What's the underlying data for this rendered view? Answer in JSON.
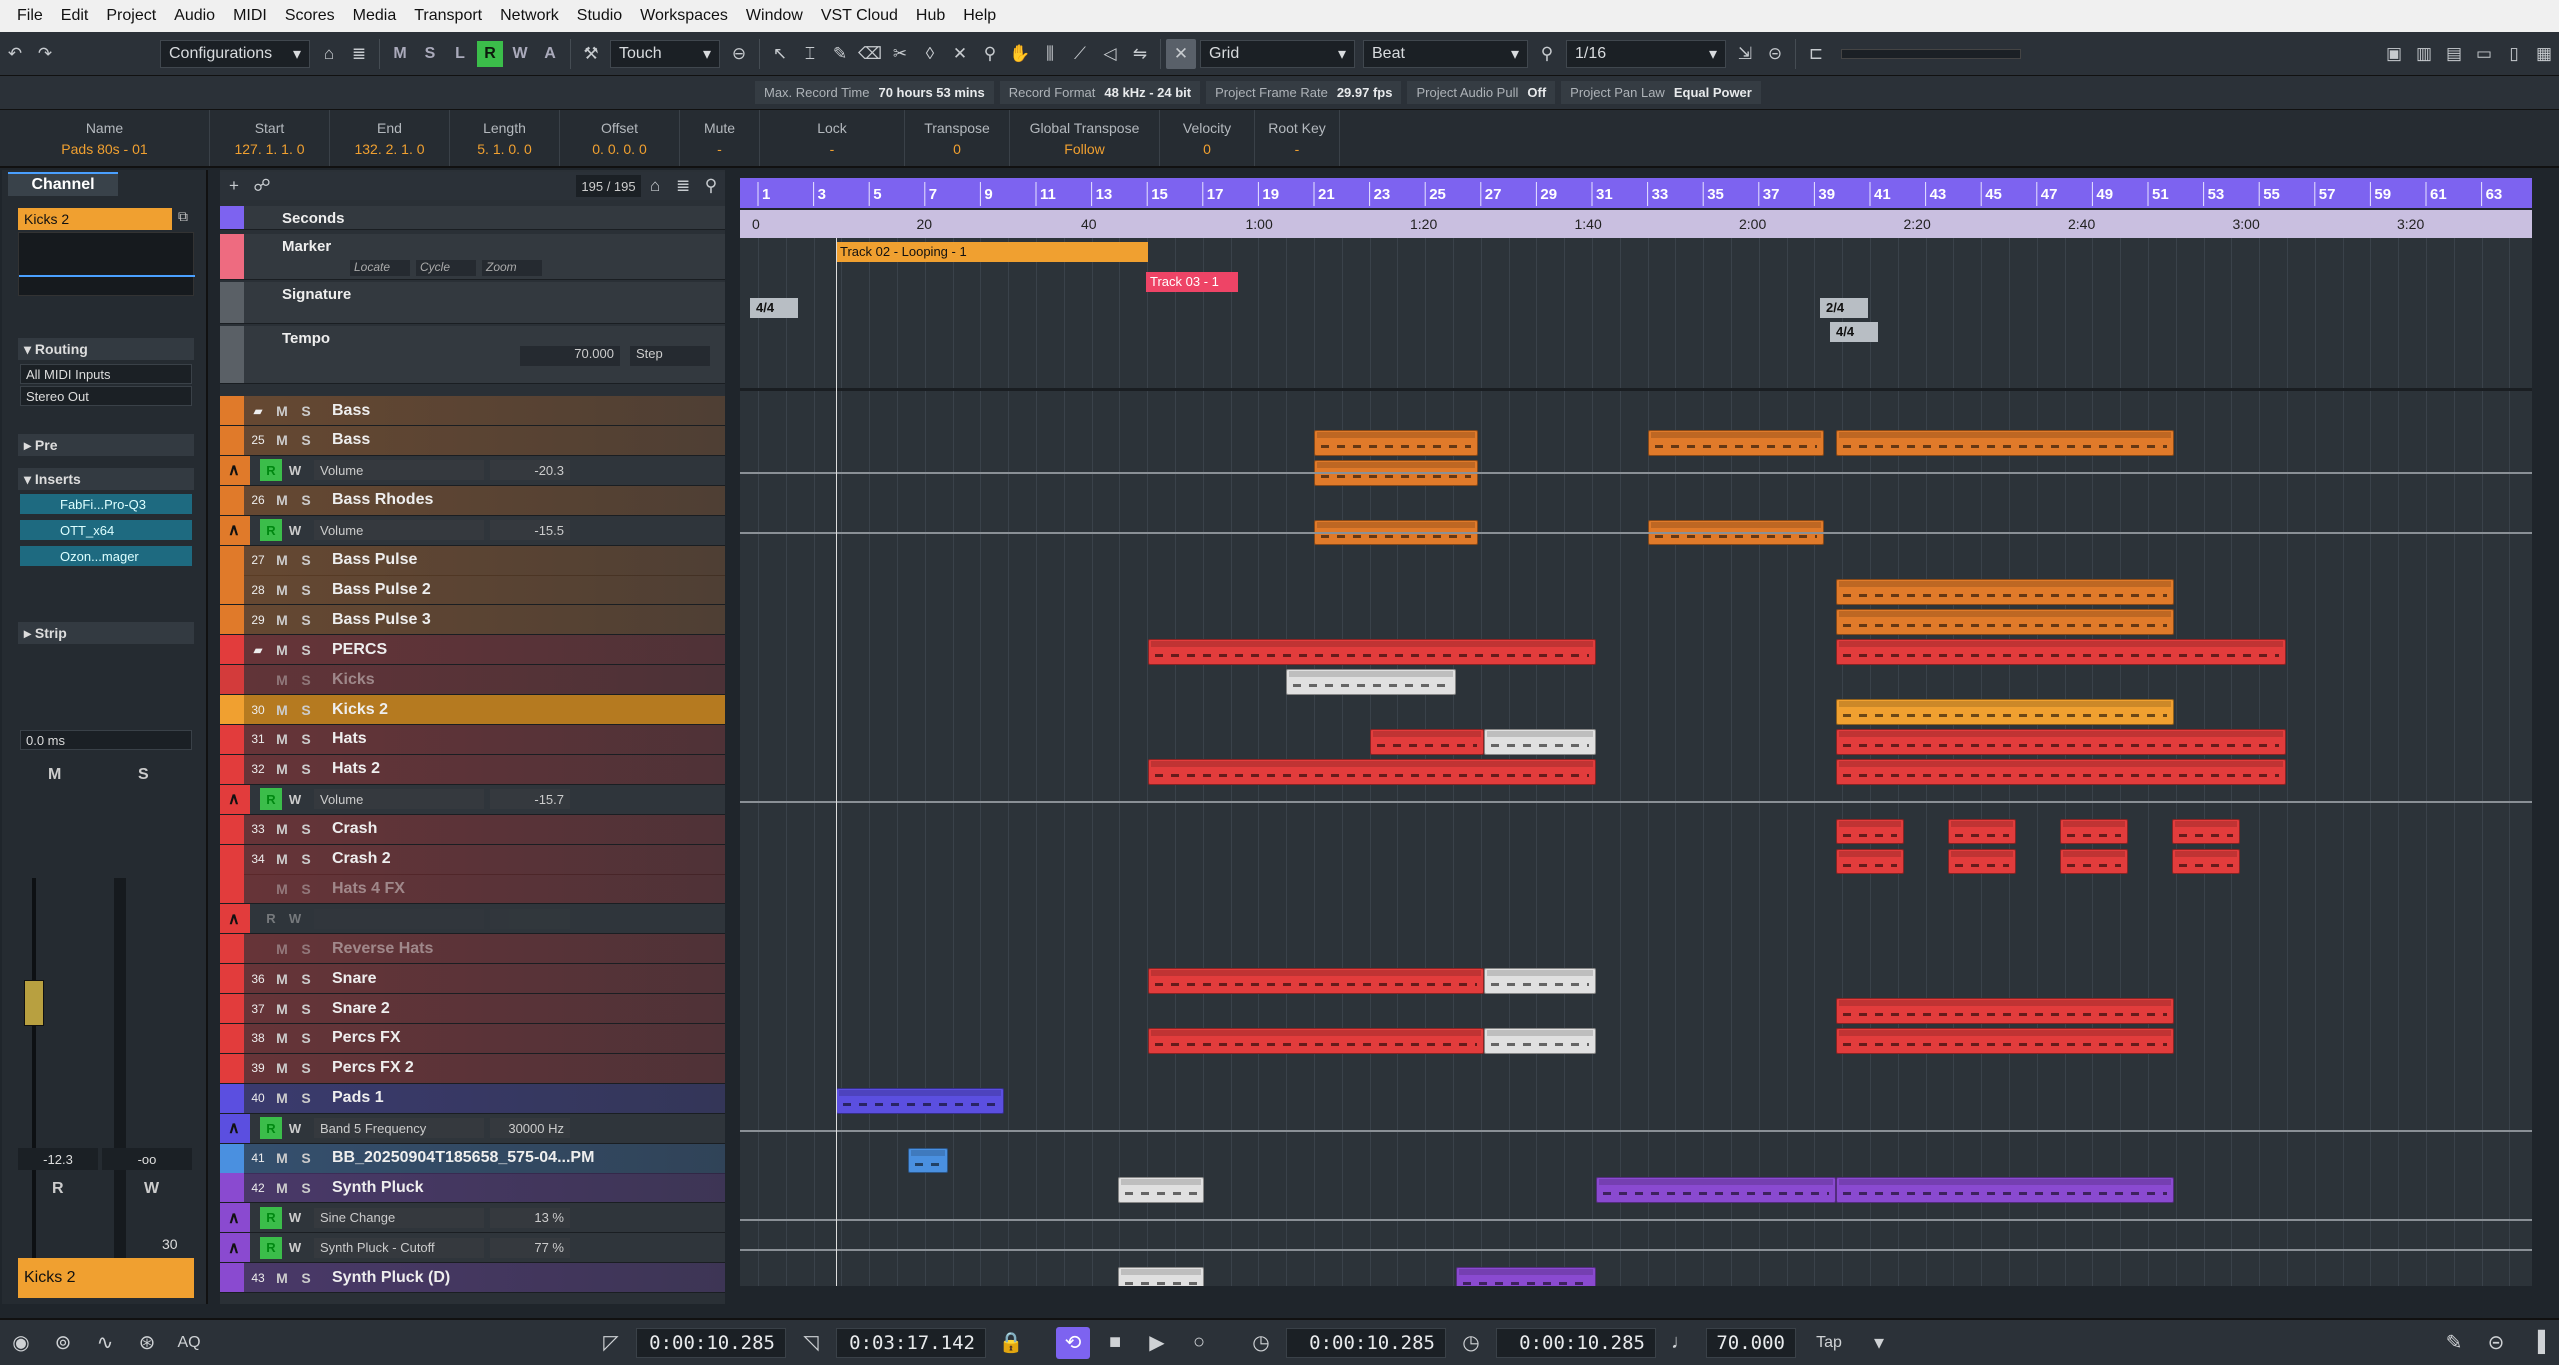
{
  "menu": [
    "File",
    "Edit",
    "Project",
    "Audio",
    "MIDI",
    "Scores",
    "Media",
    "Transport",
    "Network",
    "Studio",
    "Workspaces",
    "Window",
    "VST Cloud",
    "Hub",
    "Help"
  ],
  "toolbar": {
    "configurations": "Configurations",
    "automation_modes": [
      "M",
      "S",
      "L",
      "R",
      "W",
      "A"
    ],
    "automation_mode_active": "R",
    "touch_mode": "Touch",
    "snap_type": "Grid",
    "grid_type": "Beat",
    "quantize": "1/16"
  },
  "statusline": [
    {
      "label": "Max. Record Time",
      "value": "70 hours 53 mins"
    },
    {
      "label": "Record Format",
      "value": "48 kHz - 24 bit"
    },
    {
      "label": "Project Frame Rate",
      "value": "29.97 fps"
    },
    {
      "label": "Project Audio Pull",
      "value": "Off"
    },
    {
      "label": "Project Pan Law",
      "value": "Equal Power"
    }
  ],
  "infoline": [
    {
      "h": "Name",
      "v": "Pads 80s - 01"
    },
    {
      "h": "Start",
      "v": "127. 1. 1.   0"
    },
    {
      "h": "End",
      "v": "132. 2. 1.   0"
    },
    {
      "h": "Length",
      "v": "5. 1. 0.   0"
    },
    {
      "h": "Offset",
      "v": "0. 0. 0.   0"
    },
    {
      "h": "Mute",
      "v": "-"
    },
    {
      "h": "Lock",
      "v": "-"
    },
    {
      "h": "Transpose",
      "v": "0"
    },
    {
      "h": "Global Transpose",
      "v": "Follow"
    },
    {
      "h": "Velocity",
      "v": "0"
    },
    {
      "h": "Root Key",
      "v": "-"
    }
  ],
  "inspector": {
    "tab": "Channel",
    "track_name": "Kicks 2",
    "routing": "Routing",
    "input": "All MIDI Inputs",
    "output": "Stereo Out",
    "pre": "Pre",
    "inserts": "Inserts",
    "insert_slots": [
      "FabFi...Pro-Q3",
      "OTT_x64",
      "Ozon...mager"
    ],
    "strip": "Strip",
    "delay": "0.0 ms",
    "fader_value": "-12.3",
    "fader_peak": "-oo",
    "ch_number": "30",
    "bottom_name": "Kicks 2",
    "ms": [
      "M",
      "S"
    ],
    "rw": [
      "R",
      "W"
    ]
  },
  "tracklist": {
    "count": "195 / 195",
    "rulers": [
      {
        "name": "Seconds"
      },
      {
        "name": "Marker",
        "sub": [
          "Locate",
          "Cycle",
          "Zoom"
        ]
      },
      {
        "name": "Signature"
      },
      {
        "name": "Tempo",
        "value": "70.000",
        "mode": "Step"
      }
    ],
    "tracks": [
      {
        "type": "folder",
        "name": "Bass",
        "color": "#e07a2a"
      },
      {
        "type": "inst",
        "num": "25",
        "name": "Bass",
        "color": "#e07a2a"
      },
      {
        "type": "auto",
        "param": "Volume",
        "value": "-20.3",
        "color": "#e07a2a"
      },
      {
        "type": "inst",
        "num": "26",
        "name": "Bass Rhodes",
        "color": "#e07a2a"
      },
      {
        "type": "auto",
        "param": "Volume",
        "value": "-15.5",
        "color": "#e07a2a"
      },
      {
        "type": "inst",
        "num": "27",
        "name": "Bass Pulse",
        "color": "#e07a2a"
      },
      {
        "type": "inst",
        "num": "28",
        "name": "Bass Pulse 2",
        "color": "#e07a2a"
      },
      {
        "type": "inst",
        "num": "29",
        "name": "Bass Pulse 3",
        "color": "#e07a2a"
      },
      {
        "type": "folder",
        "name": "PERCS",
        "color": "#e23c3c"
      },
      {
        "type": "inst",
        "num": "",
        "name": "Kicks",
        "color": "#d33b3b",
        "disabled": true
      },
      {
        "type": "inst",
        "num": "30",
        "name": "Kicks 2",
        "color": "#f0a030",
        "selected": true
      },
      {
        "type": "inst",
        "num": "31",
        "name": "Hats",
        "color": "#e23c3c"
      },
      {
        "type": "inst",
        "num": "32",
        "name": "Hats 2",
        "color": "#e23c3c"
      },
      {
        "type": "auto",
        "param": "Volume",
        "value": "-15.7",
        "color": "#e23c3c"
      },
      {
        "type": "inst",
        "num": "33",
        "name": "Crash",
        "color": "#e23c3c"
      },
      {
        "type": "inst",
        "num": "34",
        "name": "Crash 2",
        "color": "#e23c3c"
      },
      {
        "type": "inst",
        "num": "",
        "name": "Hats 4 FX",
        "color": "#e23c3c",
        "disabled": true
      },
      {
        "type": "auto",
        "param": "",
        "value": "",
        "color": "#e23c3c",
        "disabled": true
      },
      {
        "type": "inst",
        "num": "",
        "name": "Reverse Hats",
        "color": "#e23c3c",
        "disabled": true
      },
      {
        "type": "inst",
        "num": "36",
        "name": "Snare",
        "color": "#e23c3c"
      },
      {
        "type": "inst",
        "num": "37",
        "name": "Snare 2",
        "color": "#e23c3c"
      },
      {
        "type": "inst",
        "num": "38",
        "name": "Percs FX",
        "color": "#e23c3c"
      },
      {
        "type": "inst",
        "num": "39",
        "name": "Percs FX 2",
        "color": "#e23c3c"
      },
      {
        "type": "inst",
        "num": "40",
        "name": "Pads 1",
        "color": "#5b4fe0"
      },
      {
        "type": "auto",
        "param": "Band 5 Frequency",
        "value": "30000 Hz",
        "color": "#5b4fe0"
      },
      {
        "type": "audio",
        "num": "41",
        "name": "BB_20250904T185658_575-04...PM",
        "color": "#4a90e0"
      },
      {
        "type": "inst",
        "num": "42",
        "name": "Synth Pluck",
        "color": "#8a4ad0"
      },
      {
        "type": "auto",
        "param": "Sine Change",
        "value": "13 %",
        "color": "#8a4ad0"
      },
      {
        "type": "auto",
        "param": "Synth Pluck - Cutoff",
        "value": "77 %",
        "color": "#8a4ad0"
      },
      {
        "type": "inst",
        "num": "43",
        "name": "Synth Pluck (D)",
        "color": "#8a4ad0"
      }
    ]
  },
  "ruler": {
    "bars": [
      "1",
      "3",
      "5",
      "7",
      "9",
      "11",
      "13",
      "15",
      "17",
      "19",
      "21",
      "23",
      "25",
      "27",
      "29",
      "31",
      "33",
      "35",
      "37",
      "39",
      "41",
      "43",
      "45",
      "47",
      "49",
      "51",
      "53",
      "55",
      "57",
      "59",
      "61",
      "63"
    ],
    "seconds": [
      "0",
      "20",
      "40",
      "1:00",
      "1:20",
      "1:40",
      "2:00",
      "2:20",
      "2:40",
      "3:00",
      "3:20"
    ],
    "markers": [
      "Track 02 - Looping -  1",
      "Track 03 -  1"
    ],
    "signatures": [
      "4/4",
      "2/4",
      "4/4"
    ]
  },
  "transport": {
    "left_locator": "0:00:10.285",
    "right_locator": "0:03:17.142",
    "primary_time": "0:00:10.285",
    "secondary_time": "0:00:10.285",
    "tempo": "70.000",
    "tap": "Tap",
    "aq": "AQ"
  },
  "colors": {
    "accent": "#7d63f0",
    "orange": "#e07a2a",
    "red": "#e23c3c",
    "purple": "#8a4ad0",
    "green": "#3bbd4a"
  }
}
